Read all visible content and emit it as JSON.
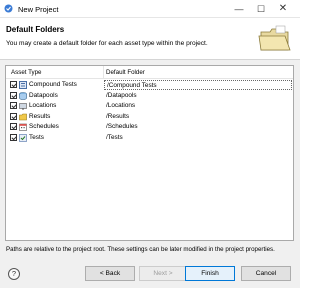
{
  "window": {
    "title": "New Project",
    "controls": {
      "minimize": "—",
      "maximize": "☐",
      "close": "✕"
    }
  },
  "banner": {
    "title": "Default Folders",
    "description": "You may create a default folder for each asset type within the project.",
    "graphic": "folder-icon"
  },
  "table": {
    "headers": {
      "asset_type": "Asset Type",
      "default_folder": "Default Folder"
    },
    "rows": [
      {
        "type": "Compound Tests",
        "folder": "/Compound Tests",
        "checked": true,
        "icon": "compound-tests-icon"
      },
      {
        "type": "Datapools",
        "folder": "/Datapools",
        "checked": true,
        "icon": "datapools-icon"
      },
      {
        "type": "Locations",
        "folder": "/Locations",
        "checked": true,
        "icon": "locations-icon"
      },
      {
        "type": "Results",
        "folder": "/Results",
        "checked": true,
        "icon": "results-icon"
      },
      {
        "type": "Schedules",
        "folder": "/Schedules",
        "checked": true,
        "icon": "schedules-icon"
      },
      {
        "type": "Tests",
        "folder": "/Tests",
        "checked": true,
        "icon": "tests-icon"
      }
    ]
  },
  "note": "Paths are relative to the project root. These settings can be later modified in the project properties.",
  "buttons": {
    "help": "?",
    "back": "< Back",
    "next": "Next >",
    "finish": "Finish",
    "cancel": "Cancel"
  },
  "colors": {
    "focus_border": "#0078d7",
    "content_bg": "#f0f0f0",
    "disabled_text": "#9c9c9c"
  }
}
